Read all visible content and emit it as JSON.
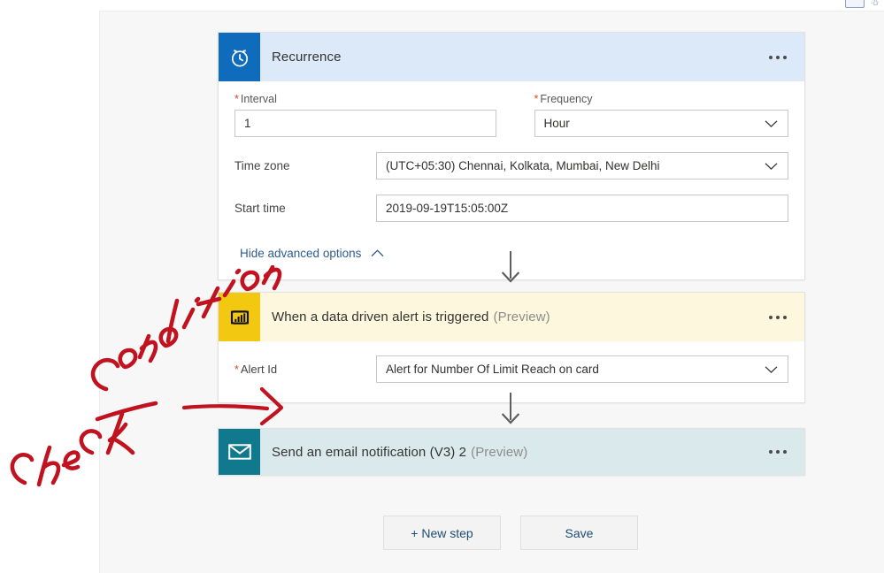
{
  "colors": {
    "canvas_bg": "#f7f7f7",
    "recurrence_header": "#dce9f9",
    "recurrence_icon": "#0f6cbd",
    "powerbi_header": "#fcf7dd",
    "powerbi_icon": "#f2c811",
    "email_header": "#daeaec",
    "email_icon": "#11798e",
    "required_star": "#d24726",
    "link_blue": "#2f5c8f",
    "ink_red": "#c1121f"
  },
  "top_strip": {
    "chip_icon": "chart-icon",
    "secondary_icon": "user-icon"
  },
  "cards": [
    {
      "id": "recurrence",
      "icon": "alarm-clock-icon",
      "title": "Recurrence",
      "preview": "",
      "menu": "more-options",
      "fields": {
        "interval": {
          "label": "Interval",
          "required": true,
          "value": "1"
        },
        "frequency": {
          "label": "Frequency",
          "required": true,
          "value": "Hour",
          "chevron": "chevron-down-icon"
        },
        "timezone": {
          "label": "Time zone",
          "required": false,
          "value": "(UTC+05:30) Chennai, Kolkata, Mumbai, New Delhi",
          "chevron": "chevron-down-icon"
        },
        "starttime": {
          "label": "Start time",
          "required": false,
          "value": "2019-09-19T15:05:00Z"
        }
      },
      "advanced_toggle": {
        "label": "Hide advanced options",
        "icon": "chevron-up-icon"
      }
    },
    {
      "id": "powerbi-alert",
      "icon": "power-bi-icon",
      "title": "When a data driven alert is triggered",
      "preview": "(Preview)",
      "menu": "more-options",
      "fields": {
        "alertid": {
          "label": "Alert Id",
          "required": true,
          "value": "Alert for Number Of Limit Reach on card",
          "chevron": "chevron-down-icon"
        }
      }
    },
    {
      "id": "send-email",
      "icon": "envelope-icon",
      "title": "Send an email notification (V3) 2",
      "preview": "(Preview)",
      "menu": "more-options"
    }
  ],
  "connectors": [
    {
      "from": "recurrence",
      "to": "powerbi-alert",
      "icon": "down-arrow-icon"
    },
    {
      "from": "powerbi-alert",
      "to": "send-email",
      "icon": "down-arrow-icon"
    }
  ],
  "footer": {
    "new_step": "+ New step",
    "save": "Save"
  },
  "annotation": {
    "text": "check condition",
    "arrow": "hand-drawn-arrow"
  }
}
